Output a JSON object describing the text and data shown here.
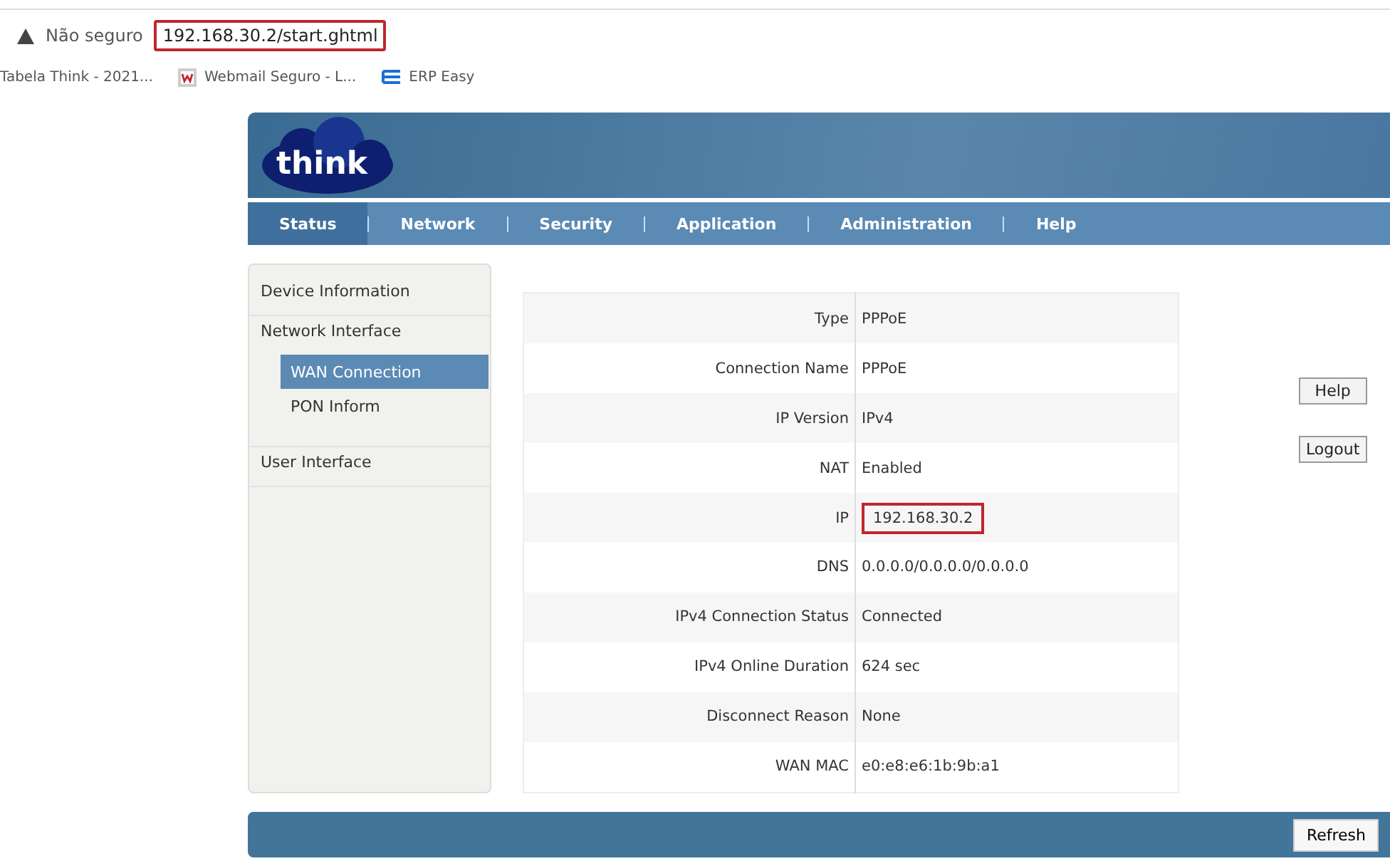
{
  "browser": {
    "security": "Não seguro",
    "url": "192.168.30.2/start.ghtml",
    "url_highlighted": true,
    "bookmarks": [
      {
        "label": "Tabela Think - 2021...",
        "kind": "none"
      },
      {
        "label": "Webmail Seguro - L...",
        "kind": "w"
      },
      {
        "label": "ERP Easy",
        "kind": "e"
      }
    ]
  },
  "logo": {
    "text": "think"
  },
  "nav": [
    {
      "label": "Status",
      "selected": true
    },
    {
      "label": "Network",
      "selected": false
    },
    {
      "label": "Security",
      "selected": false
    },
    {
      "label": "Application",
      "selected": false
    },
    {
      "label": "Administration",
      "selected": false
    },
    {
      "label": "Help",
      "selected": false
    }
  ],
  "sidebar": {
    "items": [
      {
        "label": "Device Information"
      },
      {
        "label": "Network Interface",
        "children": [
          {
            "label": "WAN Connection",
            "selected": true
          },
          {
            "label": "PON Inform",
            "selected": false
          }
        ]
      },
      {
        "label": "User Interface"
      }
    ]
  },
  "table": {
    "rows": [
      {
        "label": "Type",
        "value": "PPPoE",
        "highlighted": false
      },
      {
        "label": "Connection Name",
        "value": "PPPoE",
        "highlighted": false
      },
      {
        "label": "IP Version",
        "value": "IPv4",
        "highlighted": false
      },
      {
        "label": "NAT",
        "value": "Enabled",
        "highlighted": false
      },
      {
        "label": "IP",
        "value": "192.168.30.2",
        "highlighted": true
      },
      {
        "label": "DNS",
        "value": "0.0.0.0/0.0.0.0/0.0.0.0",
        "highlighted": false
      },
      {
        "label": "IPv4 Connection Status",
        "value": "Connected",
        "highlighted": false
      },
      {
        "label": "IPv4 Online Duration",
        "value": "624 sec",
        "highlighted": false
      },
      {
        "label": "Disconnect Reason",
        "value": "None",
        "highlighted": false
      },
      {
        "label": "WAN MAC",
        "value": "e0:e8:e6:1b:9b:a1",
        "highlighted": false
      }
    ]
  },
  "side_buttons": [
    "Help",
    "Logout"
  ],
  "footer": {
    "button": "Refresh"
  }
}
